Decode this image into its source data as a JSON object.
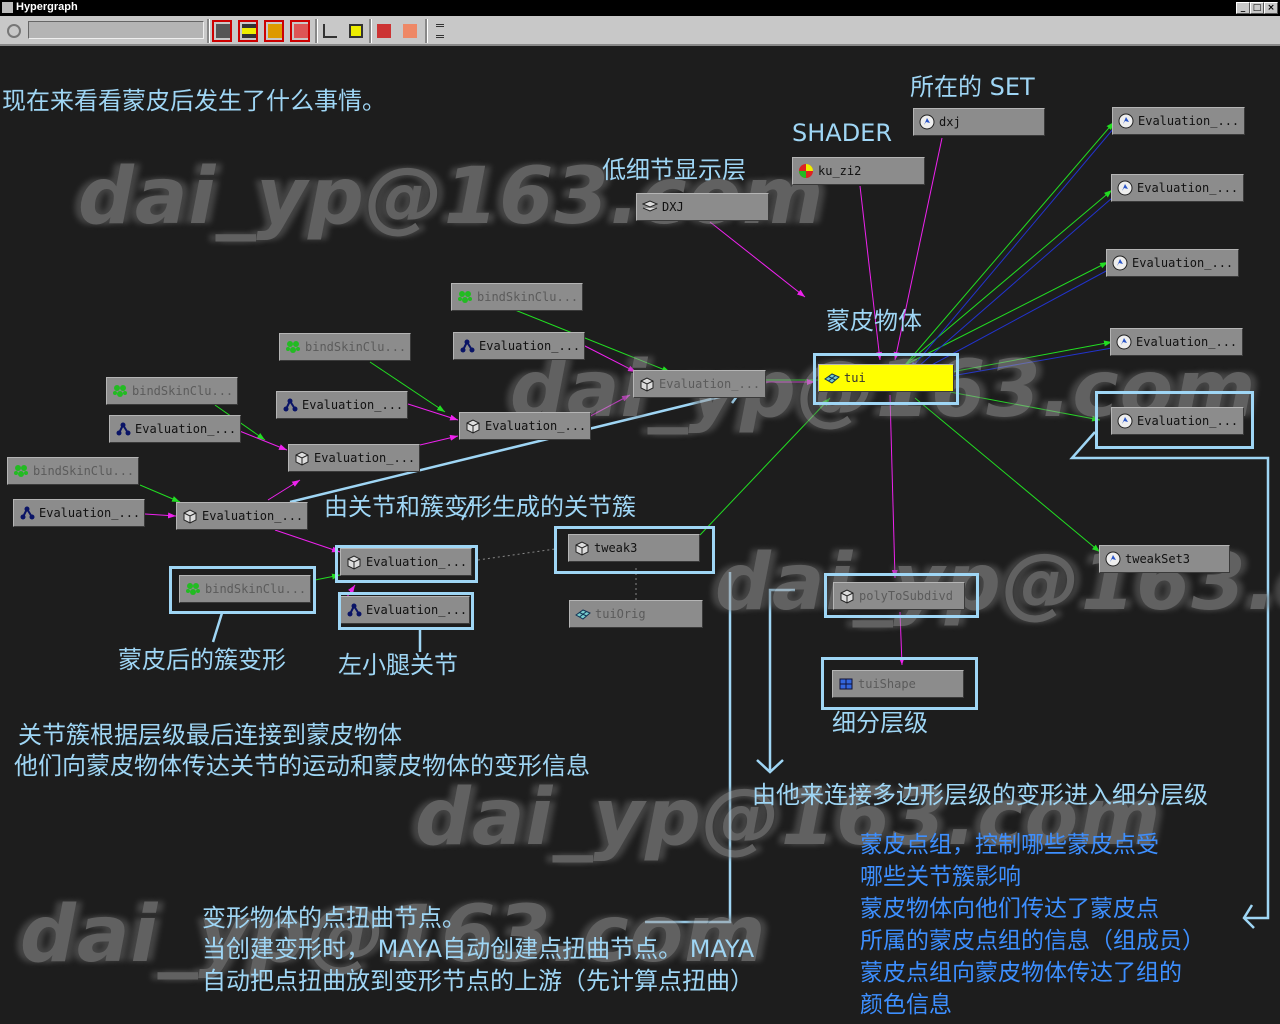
{
  "window": {
    "title": "Hypergraph"
  },
  "toolbar": {
    "icons": [
      "pan-icon",
      "graph-view-icon",
      "layout-icon",
      "scene-icon",
      "dg-icon",
      "hierarchy-icon",
      "upstream-icon",
      "add-node-icon",
      "graph-edit-icon",
      "options-icon"
    ]
  },
  "watermark": "dai_yp@163.com",
  "nodes": [
    {
      "id": "dxj",
      "label": "dxj",
      "icon": "set",
      "dim": false
    },
    {
      "id": "kuzi",
      "label": "ku_zi2",
      "icon": "shader",
      "dim": false
    },
    {
      "id": "DXJ",
      "label": "DXJ",
      "icon": "layer",
      "dim": false
    },
    {
      "id": "evR1",
      "label": "Evaluation_...",
      "icon": "eval",
      "dim": false
    },
    {
      "id": "evR2",
      "label": "Evaluation_...",
      "icon": "eval",
      "dim": false
    },
    {
      "id": "evR3",
      "label": "Evaluation_...",
      "icon": "eval",
      "dim": false
    },
    {
      "id": "evR4",
      "label": "Evaluation_...",
      "icon": "eval",
      "dim": false
    },
    {
      "id": "evR5",
      "label": "Evaluation_...",
      "icon": "eval",
      "dim": false
    },
    {
      "id": "bsc1",
      "label": "bindSkinClu...",
      "icon": "cluster",
      "dim": true
    },
    {
      "id": "j1",
      "label": "Evaluation_...",
      "icon": "joint",
      "dim": false
    },
    {
      "id": "dgTop",
      "label": "Evaluation_...",
      "icon": "cube",
      "dim": true
    },
    {
      "id": "tui",
      "label": "tui",
      "icon": "mesh",
      "dim": false,
      "selected": true
    },
    {
      "id": "bsc2",
      "label": "bindSkinClu...",
      "icon": "cluster",
      "dim": true
    },
    {
      "id": "j2",
      "label": "Evaluation_...",
      "icon": "joint",
      "dim": false
    },
    {
      "id": "dg2",
      "label": "Evaluation_...",
      "icon": "cube",
      "dim": false
    },
    {
      "id": "bsc3",
      "label": "bindSkinClu...",
      "icon": "cluster",
      "dim": true
    },
    {
      "id": "j3",
      "label": "Evaluation_...",
      "icon": "joint",
      "dim": false
    },
    {
      "id": "dg3",
      "label": "Evaluation_...",
      "icon": "cube",
      "dim": false
    },
    {
      "id": "bsc4",
      "label": "bindSkinClu...",
      "icon": "cluster",
      "dim": true
    },
    {
      "id": "j4",
      "label": "Evaluation_...",
      "icon": "joint",
      "dim": false
    },
    {
      "id": "dg4",
      "label": "Evaluation_...",
      "icon": "cube",
      "dim": false
    },
    {
      "id": "dg5",
      "label": "Evaluation_...",
      "icon": "cube",
      "dim": false
    },
    {
      "id": "tweak3",
      "label": "tweak3",
      "icon": "cube",
      "dim": false
    },
    {
      "id": "tuiOrig",
      "label": "tuiOrig",
      "icon": "mesh",
      "dim": true
    },
    {
      "id": "tweakSet3",
      "label": "tweakSet3",
      "icon": "eval",
      "dim": false
    },
    {
      "id": "bsc5",
      "label": "bindSkinClu...",
      "icon": "cluster",
      "dim": true
    },
    {
      "id": "j5",
      "label": "Evaluation_...",
      "icon": "joint",
      "dim": false
    },
    {
      "id": "polyToSubdiv",
      "label": "polyToSubdivd",
      "icon": "cube",
      "dim": true
    },
    {
      "id": "tuiShape",
      "label": "tuiShape",
      "icon": "subdiv",
      "dim": true
    }
  ],
  "annotations": {
    "intro": "现在来看看蒙皮后发生了什么事情。",
    "set": "所在的 SET",
    "shader": "SHADER",
    "lod_layer": "低细节显示层",
    "skin_object": "蒙皮物体",
    "joint_cluster": "由关节和簇变形生成的关节簇",
    "post_cluster": "蒙皮后的簇变形",
    "left_calf": "左小腿关节",
    "subdiv_level": "细分层级",
    "cluster_desc_1": "关节簇根据层级最后连接到蒙皮物体",
    "cluster_desc_2": "他们向蒙皮物体传达关节的运动和蒙皮物体的变形信息",
    "subdiv_desc": "由他来连接多边形层级的变形进入细分层级",
    "tweak_desc_1": "变形物体的点扭曲节点。",
    "tweak_desc_2": "当创建变形时， MAYA自动创建点扭曲节点。 MAYA",
    "tweak_desc_3": "自动把点扭曲放到变形节点的上游（先计算点扭曲）",
    "set_desc_1": "蒙皮点组，控制哪些蒙皮点受",
    "set_desc_2": "哪些关节簇影响",
    "set_desc_3": "蒙皮物体向他们传达了蒙皮点",
    "set_desc_4": "所属的蒙皮点组的信息（组成员）",
    "set_desc_5": "蒙皮点组向蒙皮物体传达了组的",
    "set_desc_6": "颜色信息"
  },
  "colors": {
    "annotation": "#9fd6f5",
    "annotation_blue": "#3d8fff",
    "edge_green": "#22dd22",
    "edge_magenta": "#ee22ee",
    "edge_blue": "#2233cc",
    "selected": "#ffff00"
  }
}
